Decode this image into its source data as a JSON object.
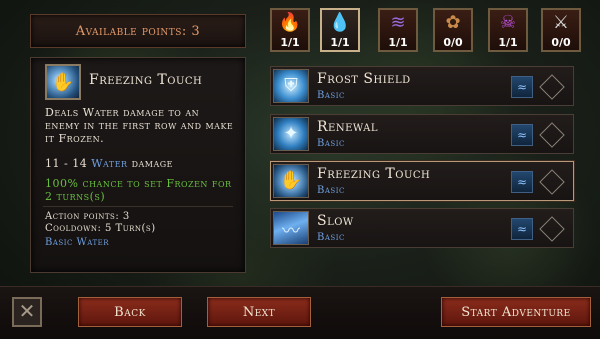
{
  "header": {
    "available_points": "Available points: 3"
  },
  "detail": {
    "icon": "freezing-touch-icon",
    "title": "Freezing Touch",
    "description": "Deals Water damage to an enemy in the first row and make it Frozen.",
    "damage_range": "11 - 14",
    "damage_type": "Water",
    "damage_word": "damage",
    "chance": "100% chance to set Frozen for 2 turns(s)",
    "action_points": "Action points: 3",
    "cooldown": "Cooldown: 5 Turn(s)",
    "tags": "Basic Water"
  },
  "schools": [
    {
      "icon": "fire-school-icon",
      "count": "1/1",
      "color": "#e0301c"
    },
    {
      "icon": "water-school-icon",
      "count": "1/1",
      "color": "#5aa0ff",
      "selected": true
    },
    {
      "icon": "air-school-icon",
      "count": "1/1",
      "color": "#9a6ae0"
    },
    {
      "icon": "earth-school-icon",
      "count": "0/0",
      "color": "#c88a4a"
    },
    {
      "icon": "dark-school-icon",
      "count": "1/1",
      "color": "#c050e0"
    },
    {
      "icon": "weapon-school-icon",
      "count": "0/0",
      "color": "#d8d8d8"
    }
  ],
  "spells": [
    {
      "name": "Frost Shield",
      "type": "Basic",
      "icon": "frost-shield-icon"
    },
    {
      "name": "Renewal",
      "type": "Basic",
      "icon": "renewal-icon"
    },
    {
      "name": "Freezing Touch",
      "type": "Basic",
      "icon": "freezing-touch-icon",
      "selected": true
    },
    {
      "name": "Slow",
      "type": "Basic",
      "icon": "slow-icon"
    }
  ],
  "buttons": {
    "back": "Back",
    "next": "Next",
    "start": "Start Adventure"
  }
}
